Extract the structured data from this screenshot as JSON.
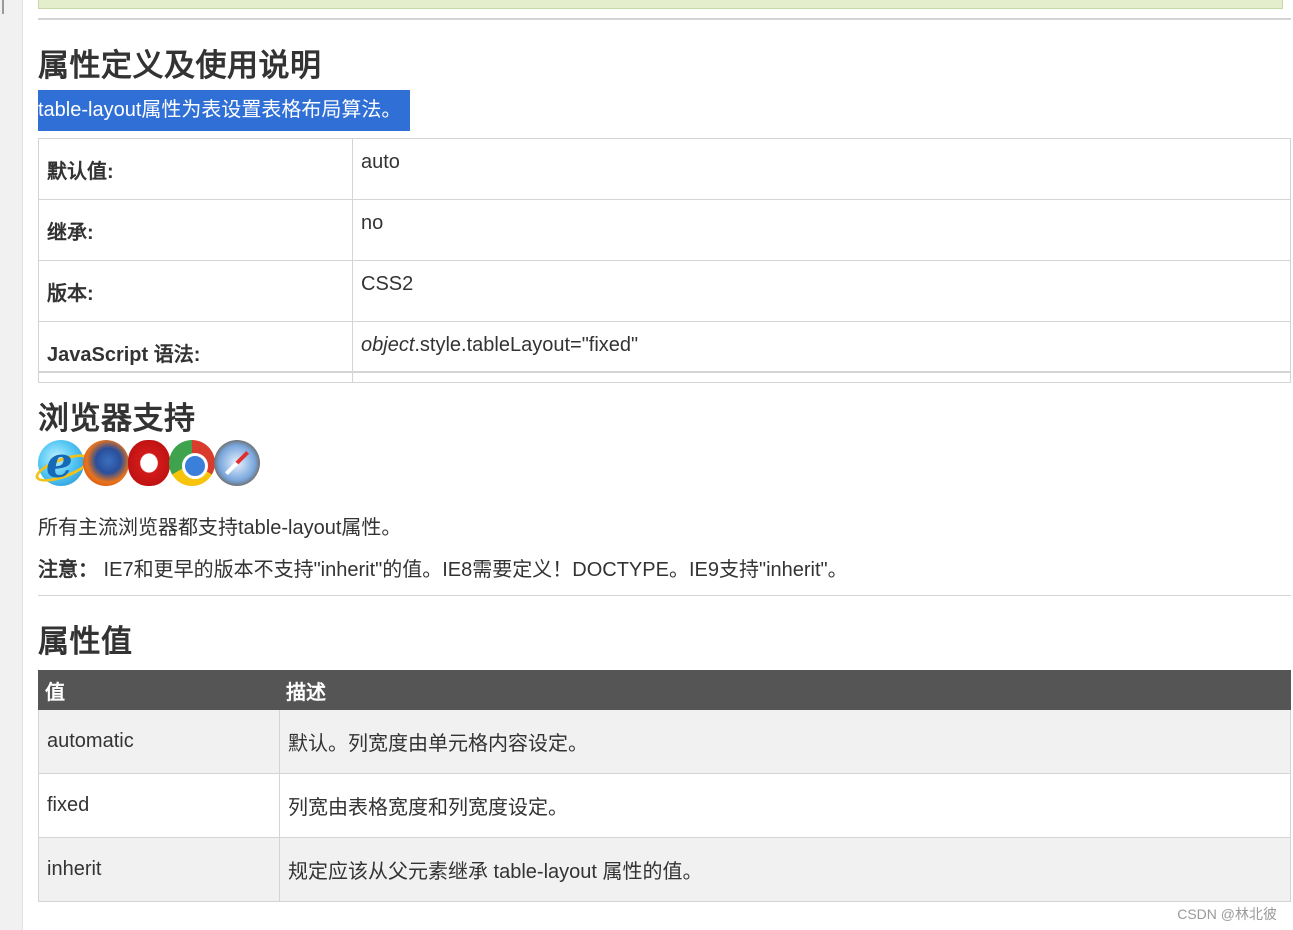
{
  "section_definition": {
    "title": "属性定义及使用说明",
    "highlight_text": "table-layout属性为表设置表格布局算法。",
    "rows": [
      {
        "key": "默认值:",
        "value": "auto"
      },
      {
        "key": "继承:",
        "value": "no"
      },
      {
        "key": "版本:",
        "value": "CSS2"
      },
      {
        "key": "JavaScript 语法:",
        "value_italic": "object",
        "value_rest": ".style.tableLayout=\"fixed\""
      }
    ]
  },
  "section_browser": {
    "title": "浏览器支持",
    "icons": [
      "internet-explorer-icon",
      "firefox-icon",
      "opera-icon",
      "chrome-icon",
      "safari-icon"
    ],
    "support_text": "所有主流浏览器都支持table-layout属性。",
    "note_label": "注意：",
    "note_text": " IE7和更早的版本不支持\"inherit\"的值。IE8需要定义！DOCTYPE。IE9支持\"inherit\"。"
  },
  "section_values": {
    "title": "属性值",
    "headers": [
      "值",
      "描述"
    ],
    "rows": [
      {
        "value": "automatic",
        "desc": "默认。列宽度由单元格内容设定。"
      },
      {
        "value": "fixed",
        "desc": "列宽由表格宽度和列宽度设定。"
      },
      {
        "value": "inherit",
        "desc": "规定应该从父元素继承 table-layout 属性的值。"
      }
    ]
  },
  "watermark": "CSDN @林北彼",
  "colors": {
    "highlight_bg": "#2f6fd6",
    "table_header_bg": "#555555",
    "note_box_bg": "#e5eecc",
    "alt_row_bg": "#f1f1f1"
  }
}
